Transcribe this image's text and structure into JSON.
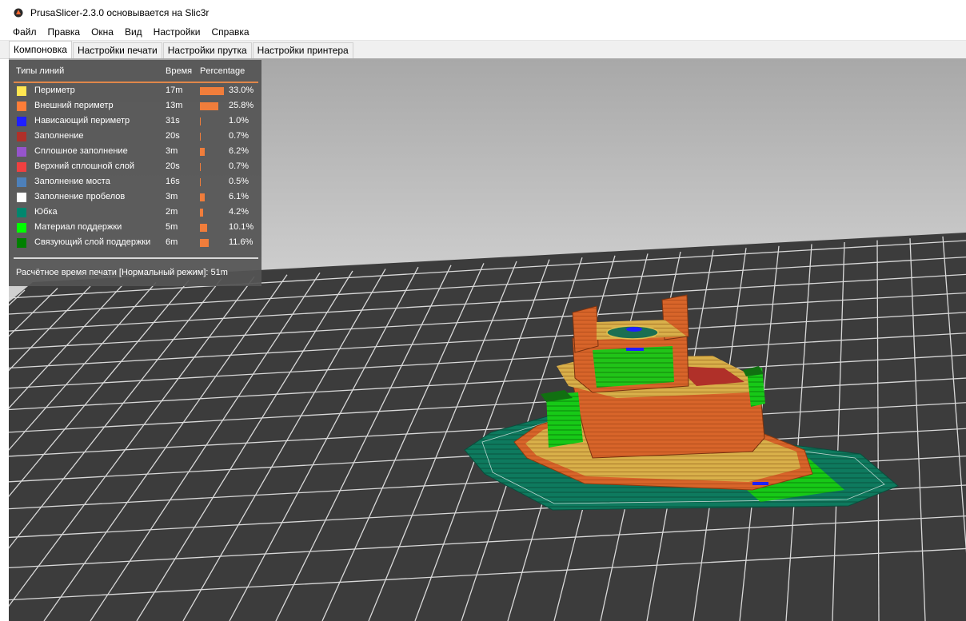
{
  "window": {
    "title": "PrusaSlicer-2.3.0 основывается на Slic3r",
    "logo_icon": "prusa-logo-icon"
  },
  "menu": {
    "items": [
      "Файл",
      "Правка",
      "Окна",
      "Вид",
      "Настройки",
      "Справка"
    ]
  },
  "tabs": {
    "items": [
      "Компоновка",
      "Настройки печати",
      "Настройки прутка",
      "Настройки принтера"
    ],
    "active_index": 0
  },
  "legend": {
    "header": {
      "col_type": "Типы линий",
      "col_time": "Время",
      "col_percent": "Percentage"
    },
    "rows": [
      {
        "label": "Периметр",
        "time": "17m",
        "percent": "33.0%",
        "value": 33.0,
        "color": "#ffe650"
      },
      {
        "label": "Внешний периметр",
        "time": "13m",
        "percent": "25.8%",
        "value": 25.8,
        "color": "#ff7d38"
      },
      {
        "label": "Нависающий периметр",
        "time": "31s",
        "percent": "1.0%",
        "value": 1.0,
        "color": "#1f1fff"
      },
      {
        "label": "Заполнение",
        "time": "20s",
        "percent": "0.7%",
        "value": 0.7,
        "color": "#b03029"
      },
      {
        "label": "Сплошное заполнение",
        "time": "3m",
        "percent": "6.2%",
        "value": 6.2,
        "color": "#9654cc"
      },
      {
        "label": "Верхний сплошной слой",
        "time": "20s",
        "percent": "0.7%",
        "value": 0.7,
        "color": "#f04040"
      },
      {
        "label": "Заполнение моста",
        "time": "16s",
        "percent": "0.5%",
        "value": 0.5,
        "color": "#4d80ba"
      },
      {
        "label": "Заполнение пробелов",
        "time": "3m",
        "percent": "6.1%",
        "value": 6.1,
        "color": "#ffffff"
      },
      {
        "label": "Юбка",
        "time": "2m",
        "percent": "4.2%",
        "value": 4.2,
        "color": "#00876e"
      },
      {
        "label": "Материал поддержки",
        "time": "5m",
        "percent": "10.1%",
        "value": 10.1,
        "color": "#00ff00"
      },
      {
        "label": "Связующий слой поддержки",
        "time": "6m",
        "percent": "11.6%",
        "value": 11.6,
        "color": "#008000"
      }
    ],
    "footer": "Расчётное время печати [Нормальный режим]:   51m"
  },
  "viewport": {
    "colors": {
      "background_top": "#a9a9a9",
      "background_bottom": "#eeeeee",
      "bed": "#3c3c3c",
      "grid": "#d9d9d9"
    }
  }
}
